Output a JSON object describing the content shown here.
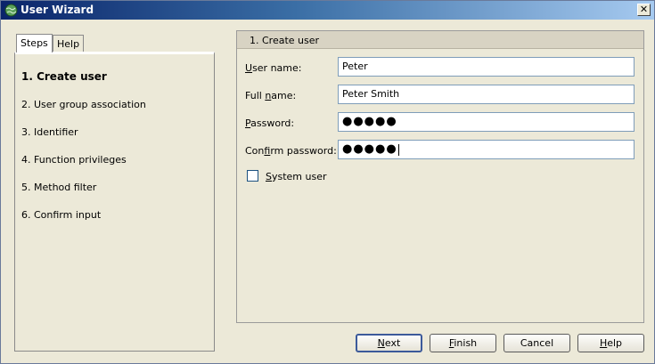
{
  "window": {
    "title": "User Wizard",
    "close_label": "✕"
  },
  "tabs": [
    {
      "label": "Steps",
      "active": true
    },
    {
      "label": "Help",
      "active": false
    }
  ],
  "steps": [
    {
      "label": "1. Create user",
      "active": true
    },
    {
      "label": "2. User group association",
      "active": false
    },
    {
      "label": "3. Identifier",
      "active": false
    },
    {
      "label": "4. Function privileges",
      "active": false
    },
    {
      "label": "5. Method filter",
      "active": false
    },
    {
      "label": "6. Confirm input",
      "active": false
    }
  ],
  "content": {
    "header": "1. Create user",
    "fields": [
      {
        "label_pre": "",
        "label_mn": "U",
        "label_post": "ser name:",
        "value": "Peter"
      },
      {
        "label_pre": "Full ",
        "label_mn": "n",
        "label_post": "ame:",
        "value": "Peter Smith"
      },
      {
        "label_pre": "",
        "label_mn": "P",
        "label_post": "assword:",
        "value": "●●●●●"
      },
      {
        "label_pre": "Con",
        "label_mn": "f",
        "label_post": "irm password:",
        "value": "●●●●●"
      }
    ],
    "system_user": {
      "label_mn": "S",
      "label_post": "ystem user",
      "checked": false
    }
  },
  "buttons": {
    "next": {
      "mn": "N",
      "rest": "ext"
    },
    "finish": {
      "mn": "F",
      "rest": "inish"
    },
    "cancel": {
      "mn": "",
      "rest": "Cancel"
    },
    "help": {
      "mn": "H",
      "rest": "elp"
    }
  }
}
